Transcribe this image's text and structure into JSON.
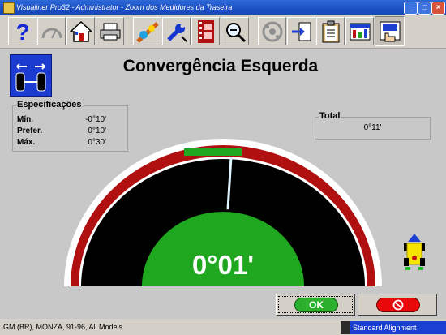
{
  "window": {
    "title": "Visualiner Pro32 - Administrator  -  Zoom dos Medidores da Traseira"
  },
  "toolbar": {
    "icons": [
      "help-icon",
      "gauge-icon",
      "home-icon",
      "printer-icon",
      "alignment-icon",
      "wrench-icon",
      "film-icon",
      "zoom-icon",
      "tire-icon",
      "export-icon",
      "clipboard-icon",
      "chart-icon",
      "hand-icon"
    ]
  },
  "header": {
    "title": "Convergência Esquerda"
  },
  "specs": {
    "label": "Especificações",
    "rows": [
      {
        "name": "Mín.",
        "value": "-0°10'"
      },
      {
        "name": "Prefer.",
        "value": "0°10'"
      },
      {
        "name": "Máx.",
        "value": "0°30'"
      }
    ]
  },
  "total": {
    "label": "Total",
    "value": "0°11'"
  },
  "gauge": {
    "reading": "0°01'",
    "needle_fraction": 0.52
  },
  "buttons": {
    "ok": "OK"
  },
  "status": {
    "left": "GM (BR), MONZA, 91-96, All Models",
    "right": "Standard Alignment"
  },
  "colors": {
    "gauge_green": "#1fa81f",
    "gauge_red": "#b01010",
    "gauge_black": "#000000",
    "title_blue": "#1a4fc4"
  }
}
